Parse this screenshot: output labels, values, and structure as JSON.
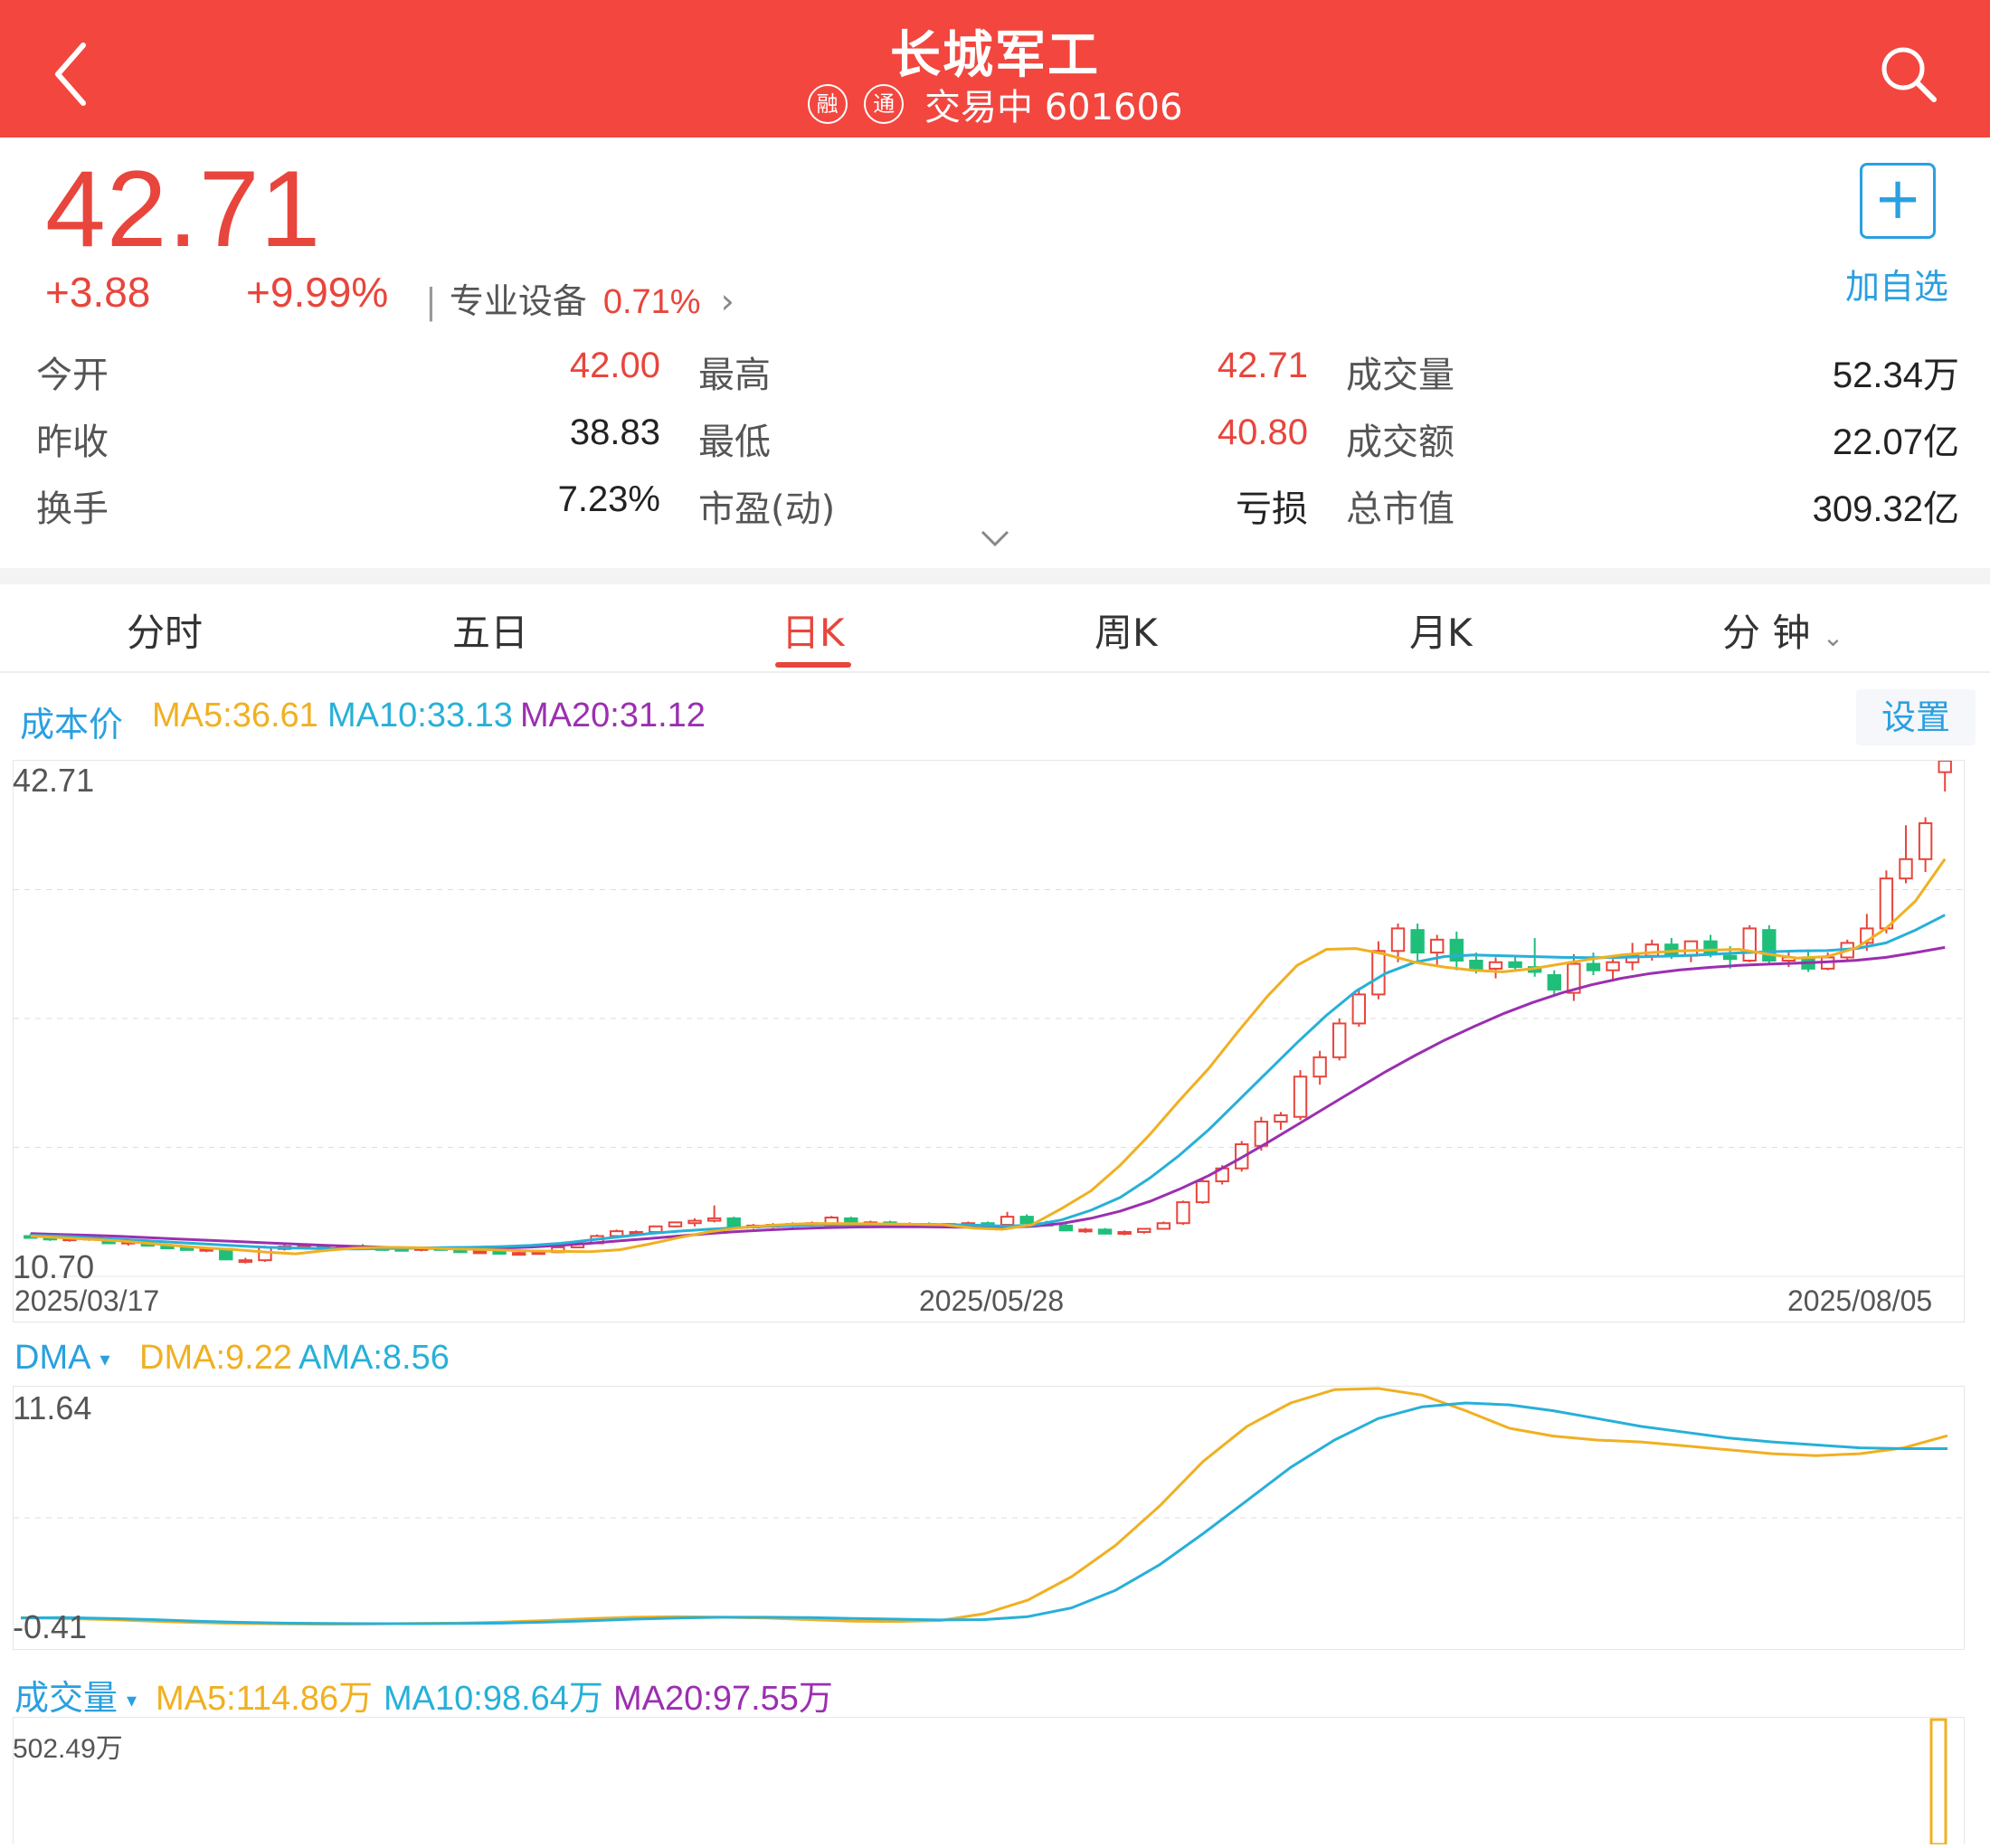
{
  "header": {
    "title": "长城军工",
    "badge_rong": "融",
    "badge_tong": "通",
    "status_code": "交易中 601606"
  },
  "quote": {
    "price": "42.71",
    "change": "+3.88",
    "change_pct": "+9.99%",
    "sector_name": "专业设备",
    "sector_pct": "0.71%",
    "add_label": "加自选"
  },
  "stats": {
    "open_label": "今开",
    "open": "42.00",
    "prev_close_label": "昨收",
    "prev_close": "38.83",
    "turnover_label": "换手",
    "turnover": "7.23%",
    "high_label": "最高",
    "high": "42.71",
    "low_label": "最低",
    "low": "40.80",
    "pe_label": "市盈(动)",
    "pe": "亏损",
    "volume_label": "成交量",
    "volume": "52.34万",
    "amount_label": "成交额",
    "amount": "22.07亿",
    "mktcap_label": "总市值",
    "mktcap": "309.32亿"
  },
  "tabs": [
    "分时",
    "五日",
    "日K",
    "周K",
    "月K",
    "分 钟"
  ],
  "active_tab": "日K",
  "kline_legend": {
    "cost": "成本价",
    "ma5": "MA5:36.61",
    "ma10": "MA10:33.13",
    "ma20": "MA20:31.12",
    "settings": "设置"
  },
  "dma_legend": {
    "name": "DMA",
    "dma": "DMA:9.22",
    "ama": "AMA:8.56"
  },
  "vol_legend": {
    "name": "成交量",
    "ma5": "MA5:114.86万",
    "ma10": "MA10:98.64万",
    "ma20": "MA20:97.55万"
  },
  "colors": {
    "up": "#e8453c",
    "down": "#1fbf7a",
    "ma5": "#f0b022",
    "ma10": "#27b0d8",
    "ma20": "#9b2fb0",
    "accent": "#2aa0e0",
    "header_bg": "#f2463f"
  },
  "chart_data": [
    {
      "type": "candlestick",
      "y_max_label": "42.71",
      "y_min_label": "10.70",
      "ylim": [
        10.7,
        42.71
      ],
      "dates": [
        "2025/03/17",
        "2025/05/28",
        "2025/08/05"
      ],
      "candles_ohlc": [
        [
          13.2,
          13.35,
          13.05,
          13.15
        ],
        [
          13.1,
          13.2,
          12.9,
          13.0
        ],
        [
          13.0,
          13.15,
          12.85,
          13.05
        ],
        [
          13.05,
          13.2,
          12.9,
          13.1
        ],
        [
          13.0,
          13.1,
          12.7,
          12.75
        ],
        [
          12.8,
          12.95,
          12.6,
          12.85
        ],
        [
          12.85,
          12.95,
          12.55,
          12.6
        ],
        [
          12.55,
          12.7,
          12.4,
          12.5
        ],
        [
          12.45,
          12.6,
          12.3,
          12.35
        ],
        [
          12.35,
          12.5,
          12.2,
          12.4
        ],
        [
          12.4,
          12.45,
          11.7,
          11.75
        ],
        [
          11.6,
          11.85,
          11.5,
          11.7
        ],
        [
          11.7,
          12.6,
          11.6,
          12.5
        ],
        [
          12.4,
          12.7,
          12.3,
          12.55
        ],
        [
          12.55,
          12.75,
          12.45,
          12.65
        ],
        [
          12.6,
          12.7,
          12.45,
          12.5
        ],
        [
          12.5,
          12.65,
          12.4,
          12.55
        ],
        [
          12.55,
          12.7,
          12.4,
          12.45
        ],
        [
          12.45,
          12.55,
          12.3,
          12.4
        ],
        [
          12.4,
          12.5,
          12.25,
          12.35
        ],
        [
          12.35,
          12.5,
          12.25,
          12.45
        ],
        [
          12.45,
          12.55,
          12.3,
          12.35
        ],
        [
          12.35,
          12.45,
          12.15,
          12.2
        ],
        [
          12.2,
          12.35,
          12.1,
          12.25
        ],
        [
          12.25,
          12.35,
          12.05,
          12.1
        ],
        [
          12.1,
          12.25,
          12.0,
          12.15
        ],
        [
          12.15,
          12.3,
          12.05,
          12.2
        ],
        [
          12.2,
          12.55,
          12.15,
          12.5
        ],
        [
          12.5,
          12.8,
          12.45,
          12.75
        ],
        [
          12.75,
          13.3,
          12.7,
          13.2
        ],
        [
          13.2,
          13.6,
          13.1,
          13.5
        ],
        [
          13.4,
          13.55,
          13.25,
          13.45
        ],
        [
          13.45,
          13.85,
          13.4,
          13.8
        ],
        [
          13.8,
          14.1,
          13.75,
          14.05
        ],
        [
          14.0,
          14.3,
          13.8,
          14.15
        ],
        [
          14.15,
          15.1,
          14.05,
          14.3
        ],
        [
          14.3,
          14.4,
          13.7,
          13.8
        ],
        [
          13.8,
          13.95,
          13.65,
          13.85
        ],
        [
          13.85,
          14.0,
          13.7,
          13.9
        ],
        [
          13.9,
          14.05,
          13.75,
          13.95
        ],
        [
          13.95,
          14.1,
          13.8,
          14.0
        ],
        [
          13.85,
          14.45,
          13.8,
          14.35
        ],
        [
          14.3,
          14.4,
          13.95,
          14.0
        ],
        [
          14.0,
          14.15,
          13.8,
          14.05
        ],
        [
          14.05,
          14.15,
          13.85,
          13.9
        ],
        [
          13.9,
          14.05,
          13.8,
          13.95
        ],
        [
          13.95,
          14.05,
          13.8,
          13.85
        ],
        [
          13.85,
          14.0,
          13.75,
          13.95
        ],
        [
          13.95,
          14.1,
          13.85,
          14.0
        ],
        [
          14.0,
          14.1,
          13.85,
          13.95
        ],
        [
          13.9,
          14.7,
          13.85,
          14.4
        ],
        [
          14.4,
          14.55,
          13.9,
          14.0
        ],
        [
          14.0,
          14.15,
          13.8,
          13.85
        ],
        [
          13.85,
          13.95,
          13.5,
          13.55
        ],
        [
          13.55,
          13.7,
          13.4,
          13.6
        ],
        [
          13.6,
          13.7,
          13.3,
          13.35
        ],
        [
          13.35,
          13.55,
          13.25,
          13.45
        ],
        [
          13.45,
          13.7,
          13.35,
          13.65
        ],
        [
          13.65,
          14.1,
          13.6,
          14.0
        ],
        [
          14.0,
          15.4,
          13.9,
          15.3
        ],
        [
          15.3,
          16.8,
          15.2,
          16.6
        ],
        [
          16.6,
          17.6,
          16.4,
          17.4
        ],
        [
          17.4,
          19.1,
          17.2,
          18.9
        ],
        [
          18.8,
          20.6,
          18.5,
          20.3
        ],
        [
          20.3,
          20.9,
          19.8,
          20.7
        ],
        [
          20.6,
          23.5,
          20.4,
          23.1
        ],
        [
          23.1,
          24.7,
          22.6,
          24.3
        ],
        [
          24.3,
          26.7,
          24.1,
          26.4
        ],
        [
          26.4,
          28.6,
          26.2,
          28.2
        ],
        [
          28.2,
          31.5,
          27.9,
          30.9
        ],
        [
          30.9,
          32.6,
          30.2,
          32.3
        ],
        [
          32.2,
          32.6,
          30.3,
          30.8
        ],
        [
          30.8,
          31.9,
          30.0,
          31.6
        ],
        [
          31.6,
          32.1,
          29.7,
          30.3
        ],
        [
          30.3,
          30.8,
          29.5,
          29.8
        ],
        [
          29.8,
          30.5,
          29.2,
          30.2
        ],
        [
          30.2,
          30.5,
          29.6,
          29.9
        ],
        [
          29.9,
          31.7,
          29.3,
          29.6
        ],
        [
          29.4,
          29.7,
          28.1,
          28.5
        ],
        [
          28.3,
          30.7,
          27.8,
          30.1
        ],
        [
          30.1,
          30.8,
          29.4,
          29.7
        ],
        [
          29.7,
          30.4,
          29.0,
          30.2
        ],
        [
          30.2,
          31.4,
          29.7,
          30.6
        ],
        [
          30.6,
          31.6,
          30.3,
          31.3
        ],
        [
          31.3,
          31.7,
          30.4,
          30.6
        ],
        [
          30.6,
          31.5,
          30.2,
          31.5
        ],
        [
          31.5,
          31.9,
          30.5,
          30.7
        ],
        [
          30.6,
          31.2,
          29.8,
          30.4
        ],
        [
          30.3,
          32.5,
          30.2,
          32.3
        ],
        [
          32.2,
          32.5,
          30.1,
          30.3
        ],
        [
          30.3,
          30.9,
          29.9,
          30.5
        ],
        [
          30.5,
          31.0,
          29.6,
          29.8
        ],
        [
          29.8,
          30.8,
          29.7,
          30.5
        ],
        [
          30.5,
          31.6,
          30.3,
          31.4
        ],
        [
          31.4,
          33.2,
          30.9,
          32.3
        ],
        [
          32.3,
          35.9,
          32.0,
          35.4
        ],
        [
          35.4,
          38.7,
          35.1,
          36.6
        ],
        [
          36.6,
          39.2,
          35.8,
          38.83
        ],
        [
          42.0,
          42.71,
          40.8,
          42.71
        ]
      ],
      "ma5": [
        13.2,
        13.1,
        13.0,
        12.9,
        12.75,
        12.6,
        12.45,
        12.35,
        12.2,
        12.1,
        12.3,
        12.45,
        12.5,
        12.48,
        12.42,
        12.38,
        12.33,
        12.28,
        12.25,
        12.23,
        12.35,
        12.7,
        13.1,
        13.45,
        13.7,
        13.85,
        13.95,
        13.98,
        13.97,
        13.95,
        13.93,
        13.9,
        13.7,
        13.62,
        13.9,
        14.9,
        16.0,
        17.6,
        19.5,
        21.6,
        23.6,
        25.9,
        28.1,
        30.0,
        31.0,
        31.05,
        30.7,
        30.2,
        29.9,
        29.7,
        29.6,
        29.8,
        30.1,
        30.4,
        30.65,
        30.8,
        30.9,
        30.95,
        31.0,
        30.7,
        30.45,
        30.55,
        31.1,
        32.3,
        34.0,
        36.61
      ],
      "ma10": [
        13.25,
        13.2,
        13.1,
        13.0,
        12.9,
        12.8,
        12.7,
        12.6,
        12.5,
        12.45,
        12.42,
        12.4,
        12.42,
        12.45,
        12.48,
        12.5,
        12.55,
        12.62,
        12.75,
        12.95,
        13.15,
        13.35,
        13.5,
        13.62,
        13.72,
        13.8,
        13.86,
        13.9,
        13.92,
        13.93,
        13.93,
        13.91,
        13.88,
        13.82,
        13.86,
        14.2,
        14.8,
        15.6,
        16.8,
        18.2,
        19.8,
        21.6,
        23.4,
        25.2,
        26.9,
        28.4,
        29.5,
        30.2,
        30.55,
        30.65,
        30.6,
        30.55,
        30.5,
        30.48,
        30.5,
        30.55,
        30.6,
        30.68,
        30.78,
        30.85,
        30.9,
        30.92,
        31.05,
        31.4,
        32.2,
        33.13
      ],
      "ma20": [
        13.35,
        13.3,
        13.25,
        13.18,
        13.1,
        13.02,
        12.94,
        12.86,
        12.78,
        12.7,
        12.62,
        12.56,
        12.5,
        12.45,
        12.42,
        12.42,
        12.45,
        12.52,
        12.62,
        12.75,
        12.9,
        13.05,
        13.2,
        13.35,
        13.48,
        13.58,
        13.66,
        13.72,
        13.76,
        13.78,
        13.78,
        13.76,
        13.74,
        13.74,
        13.8,
        13.98,
        14.3,
        14.75,
        15.35,
        16.1,
        16.95,
        17.95,
        19.0,
        20.1,
        21.2,
        22.3,
        23.4,
        24.4,
        25.35,
        26.2,
        27.0,
        27.7,
        28.3,
        28.8,
        29.2,
        29.5,
        29.72,
        29.88,
        30.0,
        30.08,
        30.15,
        30.22,
        30.32,
        30.5,
        30.8,
        31.12
      ]
    },
    {
      "type": "line",
      "name": "DMA",
      "y_max_label": "11.64",
      "y_min_label": "-0.41",
      "ylim": [
        -0.41,
        11.64
      ],
      "series": [
        {
          "name": "DMA",
          "values": [
            -0.1,
            -0.15,
            -0.2,
            -0.28,
            -0.35,
            -0.4,
            -0.42,
            -0.44,
            -0.42,
            -0.4,
            -0.38,
            -0.33,
            -0.25,
            -0.15,
            -0.08,
            -0.05,
            -0.08,
            -0.12,
            -0.2,
            -0.28,
            -0.3,
            -0.25,
            0.1,
            0.8,
            2.0,
            3.6,
            5.6,
            7.9,
            9.7,
            10.9,
            11.58,
            11.64,
            11.3,
            10.5,
            9.6,
            9.2,
            9.0,
            8.9,
            8.7,
            8.5,
            8.3,
            8.2,
            8.3,
            8.6,
            9.22
          ]
        },
        {
          "name": "AMA",
          "values": [
            -0.12,
            -0.1,
            -0.14,
            -0.2,
            -0.28,
            -0.34,
            -0.38,
            -0.4,
            -0.41,
            -0.41,
            -0.4,
            -0.38,
            -0.33,
            -0.26,
            -0.18,
            -0.12,
            -0.08,
            -0.08,
            -0.1,
            -0.14,
            -0.18,
            -0.22,
            -0.2,
            -0.05,
            0.4,
            1.3,
            2.6,
            4.2,
            5.9,
            7.6,
            9.0,
            10.1,
            10.7,
            10.9,
            10.8,
            10.5,
            10.1,
            9.7,
            9.4,
            9.1,
            8.9,
            8.75,
            8.6,
            8.56,
            8.56
          ]
        }
      ]
    },
    {
      "type": "bar",
      "name": "成交量",
      "y_max_label": "502.49万",
      "ylim": [
        0,
        502.49
      ]
    }
  ]
}
